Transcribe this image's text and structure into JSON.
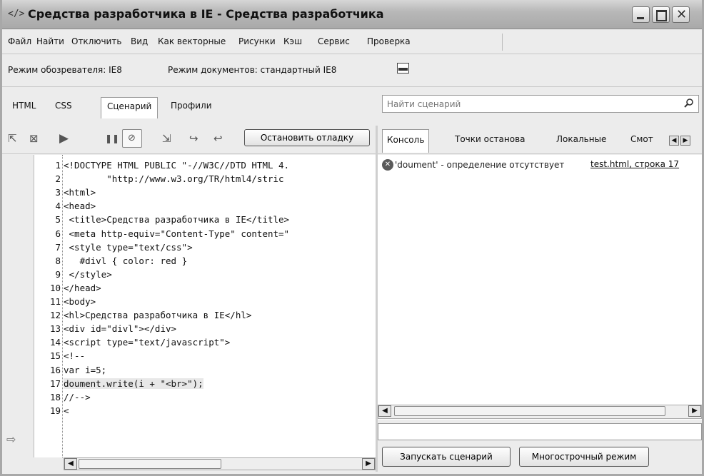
{
  "window": {
    "title": "Средства разработчика в IE - Средства разработчика",
    "icon": "developer-tools-icon"
  },
  "menu": [
    {
      "label": "Файл"
    },
    {
      "label": "Найти"
    },
    {
      "label": "Отключить"
    },
    {
      "label": "Вид"
    },
    {
      "label": "Как векторные"
    },
    {
      "label": "Рисунки"
    },
    {
      "label": "Кэш"
    },
    {
      "label": "Сервис"
    },
    {
      "label": "Проверка"
    }
  ],
  "modes": {
    "browser_mode": "Режим обозревателя: IE8",
    "document_mode": "Режим документов: стандартный IE8"
  },
  "tabs": [
    {
      "label": "HTML"
    },
    {
      "label": "CSS"
    },
    {
      "label": "Сценарий"
    },
    {
      "label": "Профили"
    }
  ],
  "active_tab": "Сценарий",
  "search": {
    "placeholder": "Найти сценарий"
  },
  "script_toolbar": {
    "stop_debug_label": "Остановить отладку"
  },
  "console_tabs": [
    {
      "label": "Консоль"
    },
    {
      "label": "Точки останова"
    },
    {
      "label": "Локальные"
    },
    {
      "label": "Смот"
    }
  ],
  "code_lines": [
    {
      "n": "1",
      "text": "<!DOCTYPE HTML PUBLIC \"-//W3C//DTD HTML 4."
    },
    {
      "n": "2",
      "text": "        \"http://www.w3.org/TR/html4/stric"
    },
    {
      "n": "3",
      "text": "<html>"
    },
    {
      "n": "4",
      "text": "<head>"
    },
    {
      "n": "5",
      "text": " <title>Средства разработчика в IE</title>"
    },
    {
      "n": "6",
      "text": " <meta http-equiv=\"Content-Type\" content=\""
    },
    {
      "n": "7",
      "text": " <style type=\"text/css\">"
    },
    {
      "n": "8",
      "text": "   #divl { color: red }"
    },
    {
      "n": "9",
      "text": " </style>"
    },
    {
      "n": "10",
      "text": "</head>"
    },
    {
      "n": "11",
      "text": "<body>"
    },
    {
      "n": "12",
      "text": "<hl>Средства разработчика в IE</hl>"
    },
    {
      "n": "13",
      "text": "<div id=\"divl\"></div>"
    },
    {
      "n": "14",
      "text": "<script type=\"text/javascript\">"
    },
    {
      "n": "15",
      "text": "<!--"
    },
    {
      "n": "16",
      "text": "var i=5;"
    },
    {
      "n": "17",
      "text": "doument.write(i + \"<br>\");"
    },
    {
      "n": "18",
      "text": "//-->"
    },
    {
      "n": "19",
      "text": "<"
    }
  ],
  "current_line": "17",
  "console": {
    "error_text": "'doument' - определение отсутствует",
    "error_location": "test.html, строка 17"
  },
  "buttons": {
    "run_script": "Запускать сценарий",
    "multiline_mode": "Многострочный режим"
  }
}
